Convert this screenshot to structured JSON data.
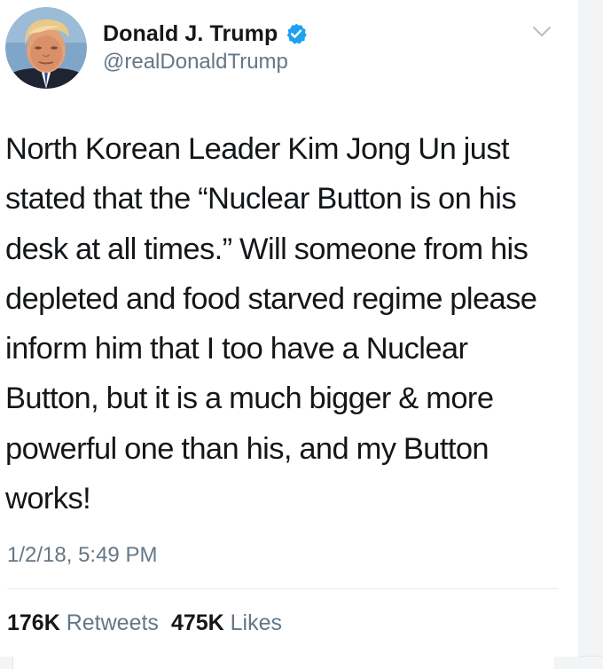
{
  "user": {
    "display_name": "Donald J. Trump",
    "handle": "@realDonaldTrump",
    "verified": true,
    "verified_color": "#1da1f2"
  },
  "tweet": {
    "text": "North Korean Leader Kim Jong Un just stated that the “Nuclear Button is on his desk at all times.” Will someone from his depleted and food starved regime please inform him that I too have a Nuclear Button, but it is a much bigger & more powerful one than his, and my Button works!",
    "timestamp": "1/2/18, 5:49 PM"
  },
  "stats": {
    "retweets_count": "176K",
    "retweets_label": "Retweets",
    "likes_count": "475K",
    "likes_label": "Likes"
  },
  "icons": {
    "menu": "chevron-down-icon",
    "verified": "verified-badge-icon"
  }
}
